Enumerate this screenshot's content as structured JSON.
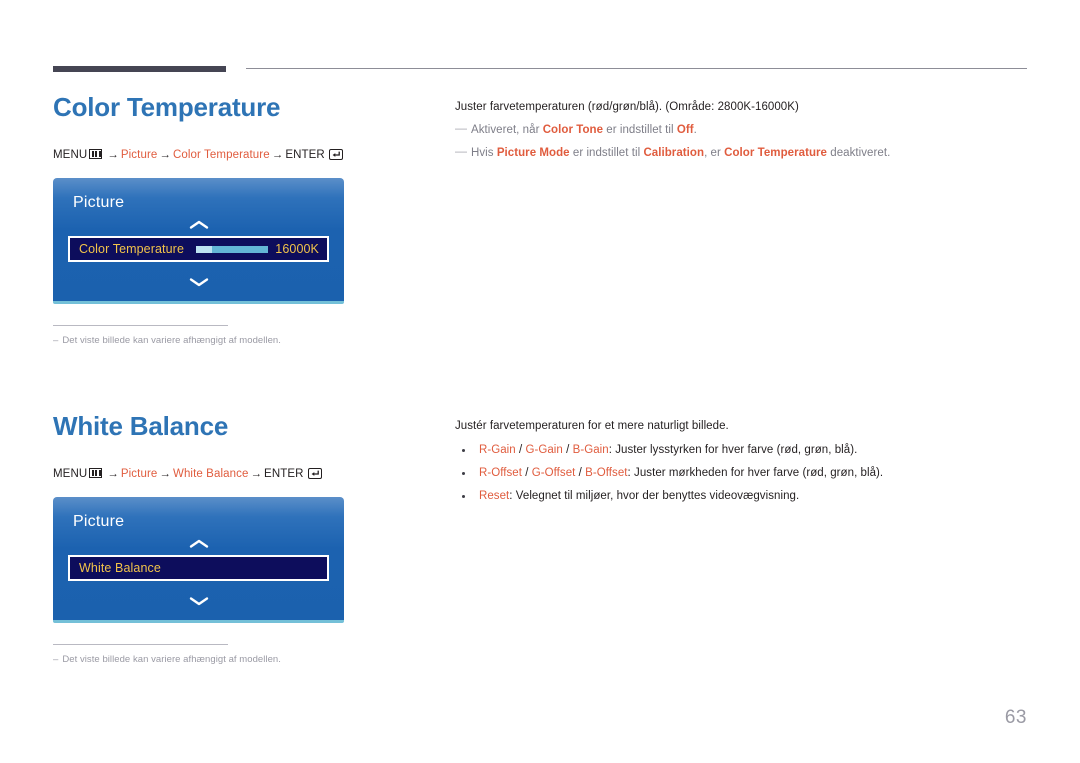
{
  "page": {
    "number": "63"
  },
  "sections": [
    {
      "title": "Color Temperature",
      "menu_path": {
        "menu_label": "MENU",
        "menu_icon": "menu-grid-icon",
        "arrow": "→",
        "step1": "Picture",
        "step2": "Color Temperature",
        "enter_label": "ENTER",
        "enter_icon": "enter-return-icon"
      },
      "osd": {
        "title": "Picture",
        "up_icon": "chevron-up-icon",
        "down_icon": "chevron-down-icon",
        "row_label": "Color Temperature",
        "row_value": "16000K",
        "has_slider": true
      },
      "caption": {
        "dash": "–",
        "text": "Det viste billede kan variere afhængigt af modellen."
      },
      "intro": "Juster farvetemperaturen (rød/grøn/blå). (Område: 2800K-16000K)",
      "notes": [
        {
          "dash": "—",
          "p1": "Aktiveret, når ",
          "k1": "Color Tone",
          "p2": " er indstillet til ",
          "k2": "Off",
          "p3": "."
        },
        {
          "dash": "—",
          "p1": "Hvis ",
          "k1": "Picture Mode",
          "p2": " er indstillet til ",
          "k2": "Calibration",
          "p3": ", er ",
          "k3": "Color Temperature",
          "p4": " deaktiveret."
        }
      ]
    },
    {
      "title": "White Balance",
      "menu_path": {
        "menu_label": "MENU",
        "menu_icon": "menu-grid-icon",
        "arrow": "→",
        "step1": "Picture",
        "step2": "White Balance",
        "enter_label": "ENTER",
        "enter_icon": "enter-return-icon"
      },
      "osd": {
        "title": "Picture",
        "up_icon": "chevron-up-icon",
        "down_icon": "chevron-down-icon",
        "row_label": "White Balance",
        "row_value": "",
        "has_slider": false
      },
      "caption": {
        "dash": "–",
        "text": "Det viste billede kan variere afhængigt af modellen."
      },
      "intro": "Justér farvetemperaturen for et mere naturligt billede.",
      "bullets": [
        {
          "k1": "R-Gain",
          "s1": " / ",
          "k2": "G-Gain",
          "s2": " / ",
          "k3": "B-Gain",
          "rest": ": Juster lysstyrken for hver farve (rød, grøn, blå)."
        },
        {
          "k1": "R-Offset",
          "s1": " / ",
          "k2": "G-Offset",
          "s2": " / ",
          "k3": "B-Offset",
          "rest": ": Juster mørkheden for hver farve (rød, grøn, blå)."
        },
        {
          "k1": "Reset",
          "s1": "",
          "k2": "",
          "s2": "",
          "k3": "",
          "rest": ": Velegnet til miljøer, hvor der benyttes videovægvisning."
        }
      ]
    }
  ],
  "colors": {
    "heading": "#2e74b5",
    "accent_orange": "#e05c3e",
    "osd_blue": "#1c62b0",
    "osd_highlight": "#0d0d5c",
    "osd_gold": "#f1c34a",
    "rule_dark": "#454553"
  }
}
